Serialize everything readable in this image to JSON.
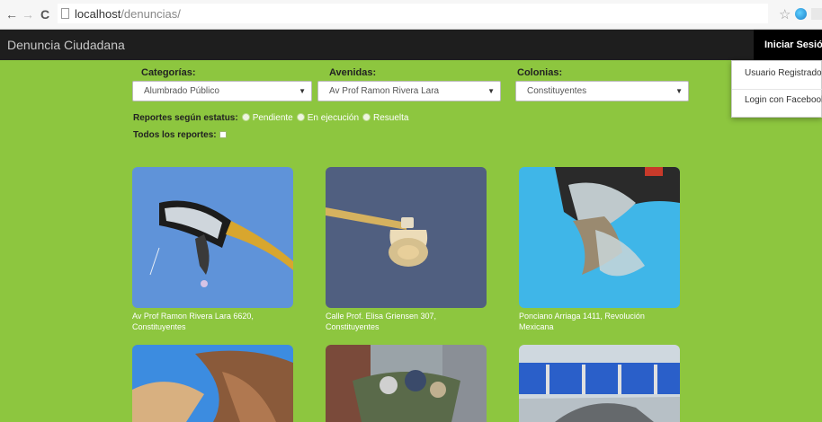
{
  "browser": {
    "url_host": "localhost",
    "url_path": "/denuncias/"
  },
  "navbar": {
    "brand": "Denuncia Ciudadana",
    "login_label": "Iniciar Sesión",
    "login_menu": [
      "Usuario Registrado",
      "Login con Facebook"
    ]
  },
  "filters": {
    "categorias": {
      "label": "Categorías:",
      "value": "Alumbrado Público"
    },
    "avenidas": {
      "label": "Avenidas:",
      "value": "Av Prof Ramon Rivera Lara"
    },
    "colonias": {
      "label": "Colonias:",
      "value": "Constituyentes"
    },
    "status_label": "Reportes según estatus:",
    "status_options": [
      "Pendiente",
      "En ejecución",
      "Resuelta"
    ],
    "todos_label": "Todos los reportes:"
  },
  "reports": [
    {
      "caption_line1": "Av Prof Ramon Rivera Lara 6620,",
      "caption_line2": "Constituyentes"
    },
    {
      "caption_line1": "Calle Prof. Elisa Griensen 307,",
      "caption_line2": "Constituyentes"
    },
    {
      "caption_line1": "Ponciano Arriaga 1411, Revolución",
      "caption_line2": "Mexicana"
    }
  ],
  "colors": {
    "page_bg": "#8dc63f",
    "navbar_bg": "#1e1e1e"
  }
}
